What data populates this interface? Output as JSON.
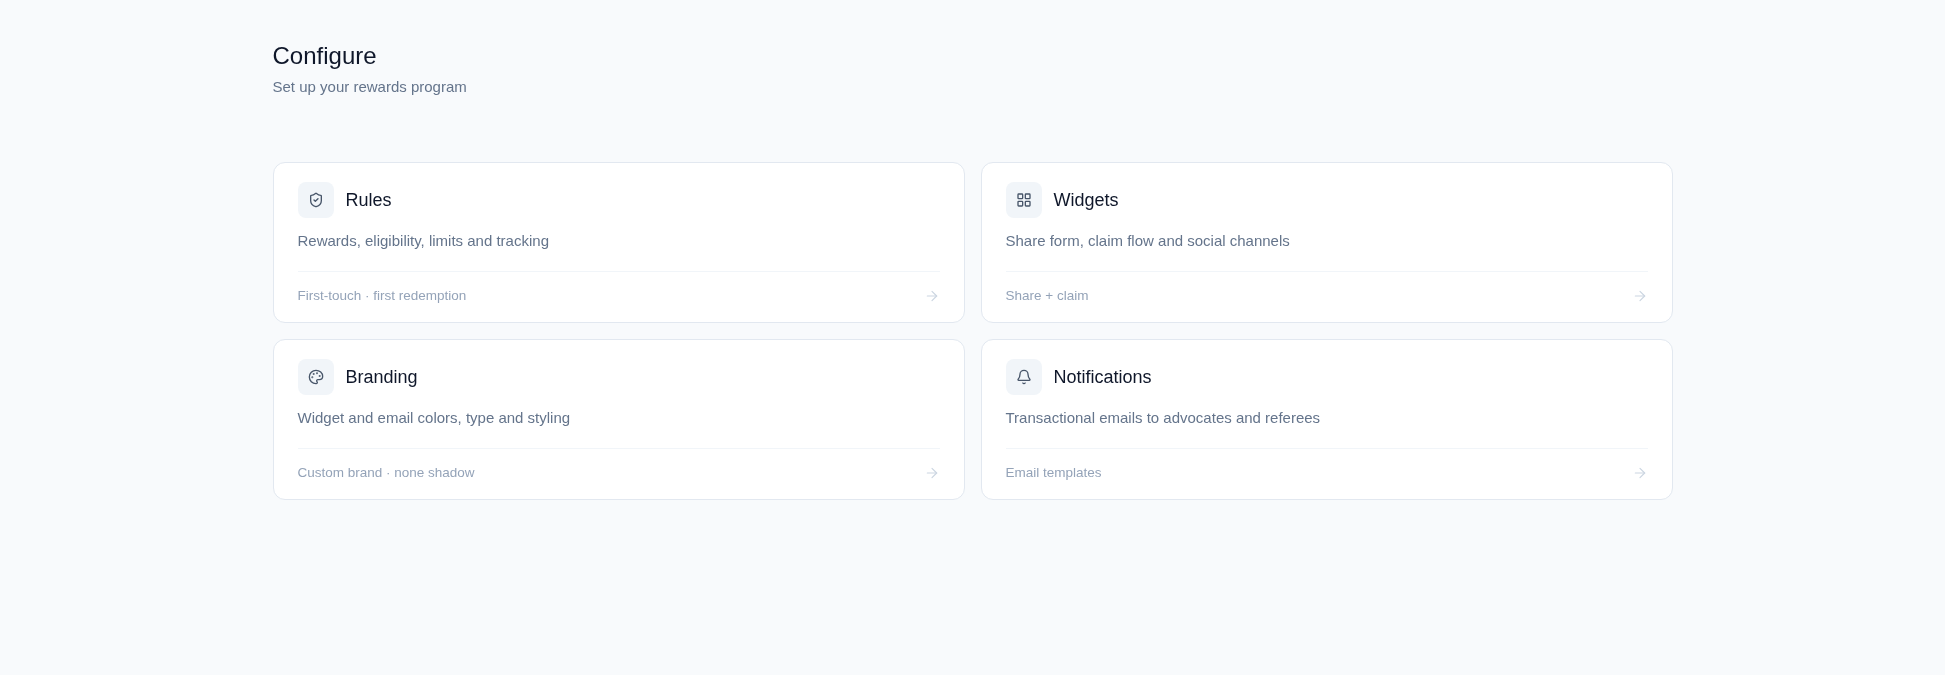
{
  "header": {
    "title": "Configure",
    "subtitle": "Set up your rewards program"
  },
  "cards": [
    {
      "title": "Rules",
      "description": "Rewards, eligibility, limits and tracking",
      "summary": "First-touch · first redemption"
    },
    {
      "title": "Widgets",
      "description": "Share form, claim flow and social channels",
      "summary": "Share + claim"
    },
    {
      "title": "Branding",
      "description": "Widget and email colors, type and styling",
      "summary": "Custom brand · none shadow"
    },
    {
      "title": "Notifications",
      "description": "Transactional emails to advocates and referees",
      "summary": "Email templates"
    }
  ]
}
